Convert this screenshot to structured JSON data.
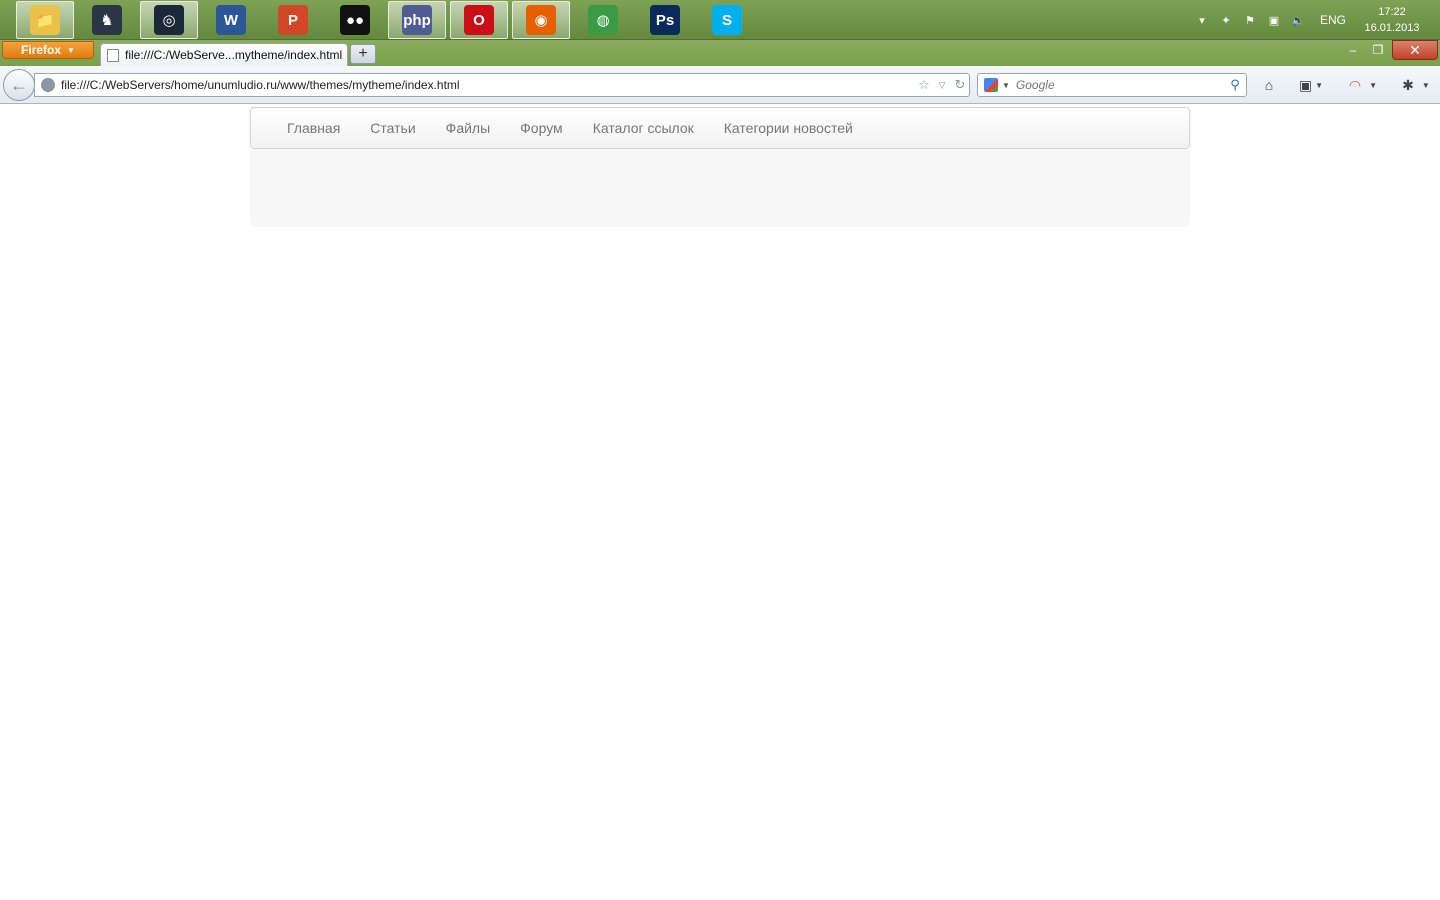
{
  "taskbar": {
    "apps": [
      {
        "name": "explorer-icon",
        "glyph": "📁",
        "color": "#e8c24a",
        "active": true
      },
      {
        "name": "counter-strike-icon",
        "glyph": "♞",
        "color": "#2a3546",
        "active": false
      },
      {
        "name": "steam-icon",
        "glyph": "◎",
        "color": "#1b2838",
        "active": true
      },
      {
        "name": "word-icon",
        "glyph": "W",
        "color": "#2b579a",
        "active": false
      },
      {
        "name": "powerpoint-icon",
        "glyph": "P",
        "color": "#d24726",
        "active": false
      },
      {
        "name": "qip-icon",
        "glyph": "●●",
        "color": "#111111",
        "active": false
      },
      {
        "name": "php-icon",
        "glyph": "php",
        "color": "#4f5b93",
        "active": true
      },
      {
        "name": "opera-icon",
        "glyph": "O",
        "color": "#cc0f16",
        "active": true
      },
      {
        "name": "firefox-icon",
        "glyph": "◉",
        "color": "#e66000",
        "active": true
      },
      {
        "name": "chrome-icon",
        "glyph": "◍",
        "color": "#3b9a44",
        "active": false
      },
      {
        "name": "photoshop-icon",
        "glyph": "Ps",
        "color": "#0a2a5a",
        "active": false
      },
      {
        "name": "skype-icon",
        "glyph": "S",
        "color": "#00aff0",
        "active": false
      }
    ],
    "tray": {
      "language": "ENG",
      "time": "17:22",
      "date": "16.01.2013"
    }
  },
  "browser": {
    "menu_button": "Firefox",
    "tab_title": "file:///C:/WebServe...mytheme/index.html",
    "new_tab": "+",
    "window_controls": {
      "minimize": "–",
      "maximize": "❐",
      "close": "✕"
    },
    "url": "file:///C:/WebServers/home/unumludio.ru/www/themes/mytheme/index.html",
    "search_placeholder": "Google"
  },
  "site": {
    "nav": [
      "Главная",
      "Статьи",
      "Файлы",
      "Форум",
      "Каталог ссылок",
      "Категории новостей"
    ]
  }
}
